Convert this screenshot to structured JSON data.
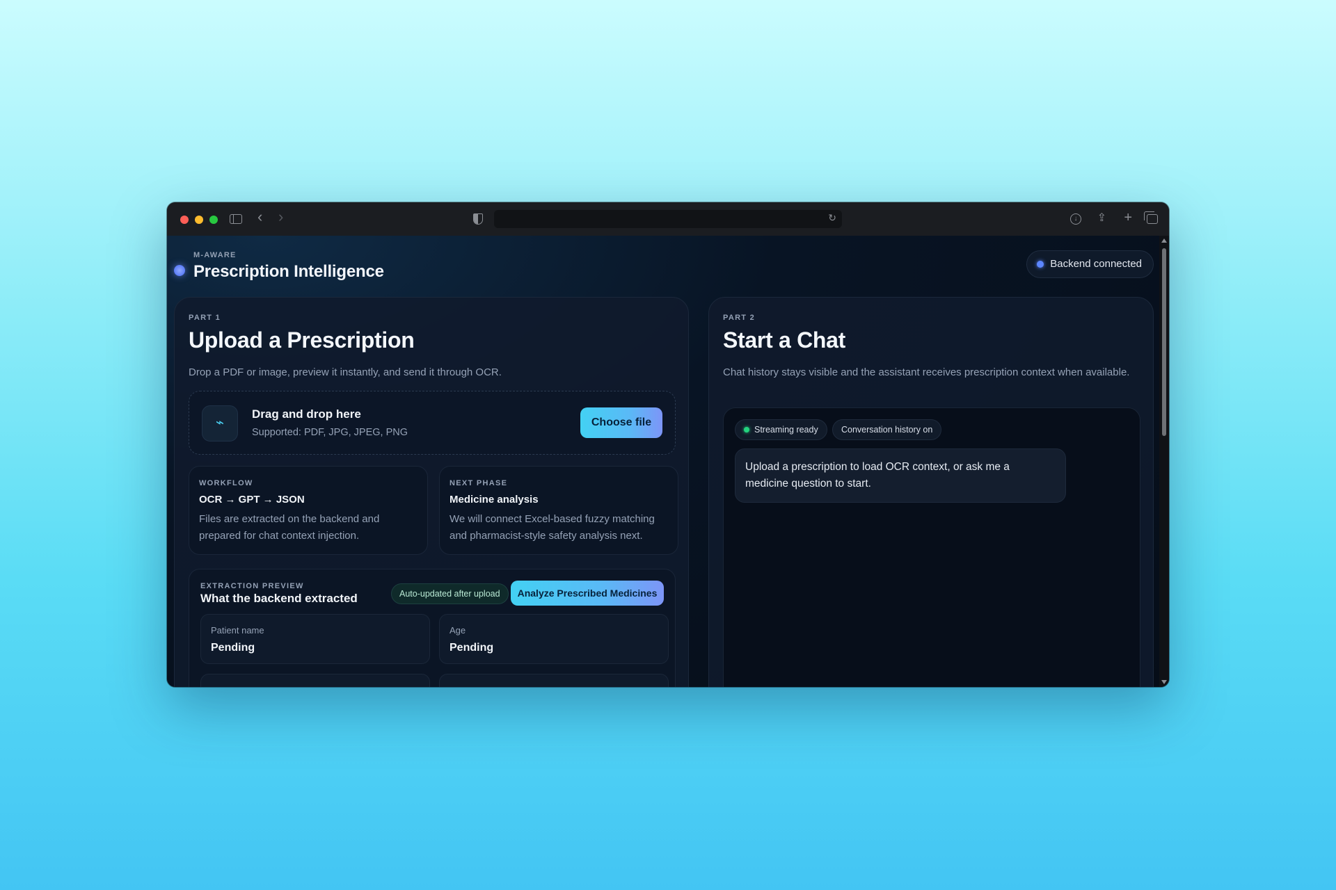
{
  "app": {
    "kicker": "M-AWARE",
    "title": "Prescription Intelligence",
    "status": "Backend connected"
  },
  "upload_panel": {
    "kicker": "PART 1",
    "title": "Upload a Prescription",
    "subtitle": "Drop a PDF or image, preview it instantly, and send it through OCR.",
    "dropzone": {
      "title": "Drag and drop here",
      "supported": "Supported: PDF, JPG, JPEG, PNG",
      "button": "Choose file"
    },
    "workflow": {
      "kicker": "WORKFLOW",
      "title": "OCR → GPT → JSON",
      "body": "Files are extracted on the backend and prepared for chat context injection."
    },
    "next_phase": {
      "kicker": "NEXT PHASE",
      "title": "Medicine analysis",
      "body": "We will connect Excel-based fuzzy matching and pharmacist-style safety analysis next."
    },
    "extraction": {
      "kicker": "EXTRACTION PREVIEW",
      "title": "What the backend extracted",
      "badge": "Auto-updated after upload",
      "button": "Analyze Prescribed Medicines",
      "fields": [
        {
          "label": "Patient name",
          "value": "Pending"
        },
        {
          "label": "Age",
          "value": "Pending"
        }
      ]
    }
  },
  "chat_panel": {
    "kicker": "PART 2",
    "title": "Start a Chat",
    "subtitle": "Chat history stays visible and the assistant receives prescription context when available.",
    "chips": {
      "streaming": "Streaming ready",
      "history": "Conversation history on"
    },
    "messages": [
      {
        "role": "assistant",
        "text": "Upload a prescription to load OCR context, or ask me a medicine question to start."
      }
    ]
  },
  "colors": {
    "accent_gradient_start": "#43d1f3",
    "accent_gradient_end": "#7d95f7",
    "status_dot": "#5c86ff",
    "ready_dot": "#23d27e"
  }
}
